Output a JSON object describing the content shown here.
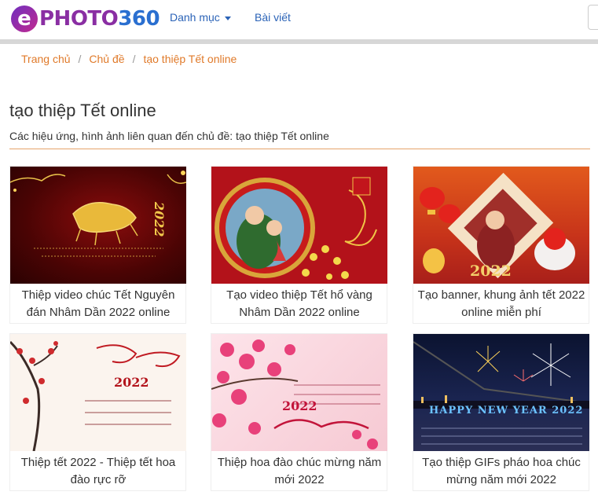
{
  "header": {
    "logo_e": "e",
    "logo_photo": "PHOTO",
    "logo_num": "360",
    "nav_categories": "Danh mục",
    "nav_posts": "Bài viết"
  },
  "breadcrumb": {
    "home": "Trang chủ",
    "topics": "Chủ đề",
    "current": "tạo thiệp Tết online",
    "separator": "/"
  },
  "main": {
    "title": "tạo thiệp Tết online",
    "description": "Các hiệu ứng, hình ảnh liên quan đến chủ đề: tạo thiệp Tết online"
  },
  "cards": [
    {
      "title": "Thiệp video chúc Tết Nguyên đán Nhâm Dần 2022 online",
      "thumb_text": "2022"
    },
    {
      "title": "Tạo video thiệp Tết hổ vàng Nhâm Dần 2022 online",
      "thumb_text": ""
    },
    {
      "title": "Tạo banner, khung ảnh tết 2022 online miễn phí",
      "thumb_text": "2022"
    },
    {
      "title": "Thiệp tết 2022 - Thiệp tết hoa đào rực rỡ",
      "thumb_text": "2022"
    },
    {
      "title": "Thiệp hoa đào chúc mừng năm mới 2022",
      "thumb_text": "2022"
    },
    {
      "title": "Tạo thiệp GIFs pháo hoa chúc mừng năm mới 2022",
      "thumb_text": "HAPPY NEW YEAR 2022"
    }
  ],
  "colors": {
    "link": "#2b63b7",
    "breadcrumb": "#e07a2a",
    "divider": "#e6a36a"
  }
}
